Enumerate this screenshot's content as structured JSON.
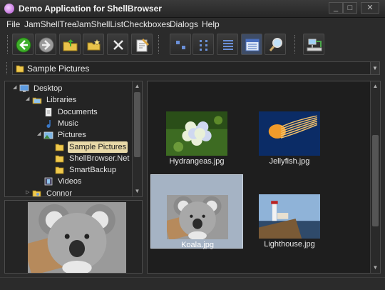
{
  "window": {
    "title": "Demo Application for ShellBrowser",
    "controls": [
      "_",
      "□",
      "✕"
    ]
  },
  "menu": [
    "File",
    "JamShellTree",
    "JamShellList",
    "Checkboxes",
    "Dialogs",
    "Help"
  ],
  "toolbar": {
    "buttons": [
      "back-icon",
      "forward-icon",
      "folder-up-icon",
      "new-folder-icon",
      "delete-icon",
      "properties-icon",
      "large-icons-icon",
      "small-icons-icon",
      "list-view-icon",
      "details-view-icon",
      "search-icon",
      "network-icon"
    ]
  },
  "address": {
    "value": "Sample Pictures"
  },
  "tree": {
    "items": [
      {
        "label": "Desktop",
        "icon": "desktop-icon",
        "level": 0
      },
      {
        "label": "Libraries",
        "icon": "libraries-icon",
        "level": 1
      },
      {
        "label": "Documents",
        "icon": "documents-icon",
        "level": 2
      },
      {
        "label": "Music",
        "icon": "music-icon",
        "level": 2
      },
      {
        "label": "Pictures",
        "icon": "pictures-icon",
        "level": 2
      },
      {
        "label": "Sample Pictures",
        "icon": "folder-icon",
        "level": 3,
        "selected": true
      },
      {
        "label": "ShellBrowser.Net",
        "icon": "folder-icon",
        "level": 3
      },
      {
        "label": "SmartBackup",
        "icon": "folder-icon",
        "level": 3
      },
      {
        "label": "Videos",
        "icon": "videos-icon",
        "level": 2
      },
      {
        "label": "Connor",
        "icon": "user-folder-icon",
        "level": 1
      }
    ]
  },
  "files": [
    {
      "name": "Hydrangeas.jpg",
      "thumb": "hydrangea"
    },
    {
      "name": "Jellyfish.jpg",
      "thumb": "jellyfish"
    },
    {
      "name": "Koala.jpg",
      "thumb": "koala",
      "selected": true
    },
    {
      "name": "Lighthouse.jpg",
      "thumb": "lighthouse"
    }
  ],
  "preview": {
    "thumb": "koala"
  },
  "colors": {
    "selection_tree": "#e8d9a8",
    "selection_list": "#a5b3c4",
    "background": "#2b2b2b"
  }
}
